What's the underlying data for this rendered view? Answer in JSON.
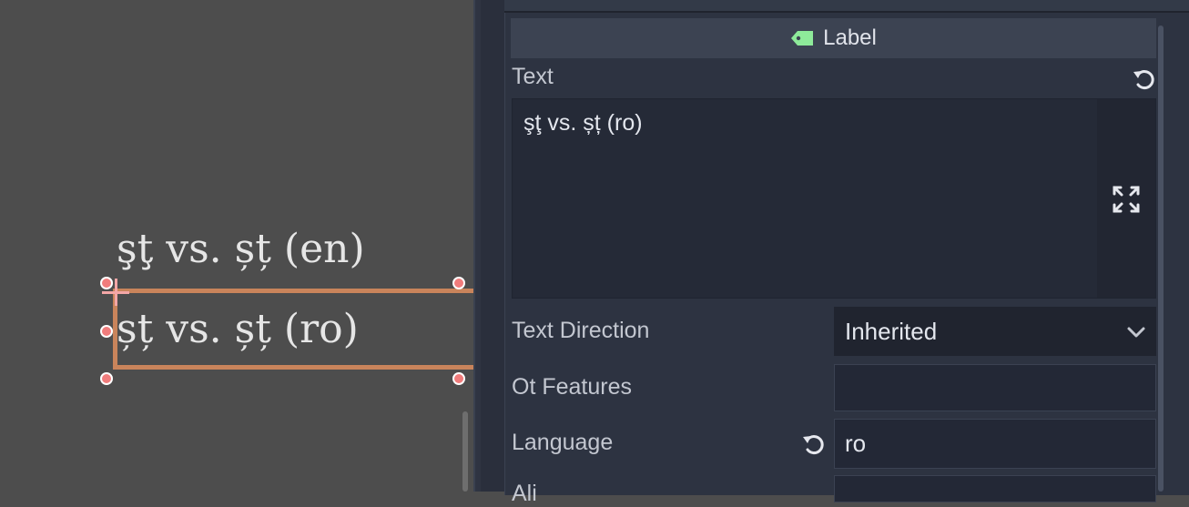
{
  "viewport": {
    "label_en_text": "şţ vs. șț (en)",
    "label_ro_text": "șț vs. șț (ro)"
  },
  "inspector": {
    "category_header": "Label",
    "text_property": {
      "name": "Text",
      "value": "şţ vs. șț (ro)"
    },
    "text_direction": {
      "name": "Text Direction",
      "value": "Inherited"
    },
    "ot_features": {
      "name": "Ot Features",
      "value": ""
    },
    "language": {
      "name": "Language",
      "value": "ro"
    },
    "next_property": {
      "name": "Ali"
    }
  },
  "colors": {
    "viewport_bg": "#4d4d4d",
    "selection": "#c9845b",
    "handle": "#f07c7c",
    "inspector_bg": "#2d3341",
    "label_icon": "#8eea9a"
  },
  "icons": [
    "label-tag-icon",
    "reset-icon",
    "expand-icon",
    "chevron-down-icon"
  ]
}
